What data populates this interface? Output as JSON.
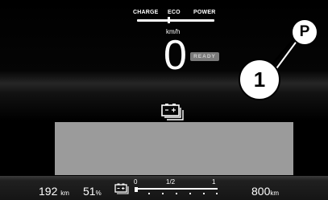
{
  "drive_modes": {
    "charge": "CHARGE",
    "eco": "ECO",
    "power": "POWER"
  },
  "speed": {
    "unit": "km/h",
    "value": "0",
    "status": "READY"
  },
  "callouts": {
    "p": "P",
    "one": "1"
  },
  "icons": {
    "battery_center": "battery-stack-icon",
    "battery_small": "battery-stack-icon"
  },
  "bottom": {
    "range_value": "192",
    "range_unit": "km",
    "soc_value": "51",
    "soc_unit": "%",
    "gauge_labels": [
      "0",
      "1/2",
      "1"
    ],
    "gauge_level": 0.04,
    "range2_value": "800",
    "range2_unit": "km"
  },
  "colors": {
    "panel": "#9b9b9b",
    "background": "#000000",
    "ready_badge": "#7a7a7a"
  }
}
